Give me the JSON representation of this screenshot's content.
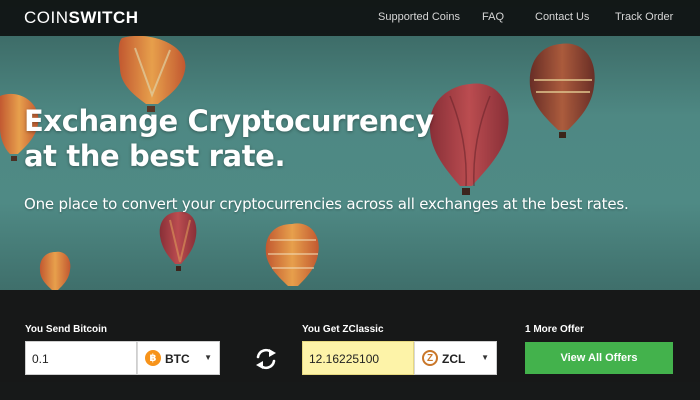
{
  "header": {
    "logo_part1": "COIN",
    "logo_part2": "SWITCH",
    "nav": [
      "Supported Coins",
      "FAQ",
      "Contact Us",
      "Track Order"
    ]
  },
  "hero": {
    "headline_line1": "Exchange Cryptocurrency",
    "headline_line2": "at the best rate.",
    "subheadline": "One place to convert your cryptocurrencies across all exchanges at the best rates."
  },
  "exchange": {
    "send": {
      "label": "You Send Bitcoin",
      "amount": "0.1",
      "coin_code": "BTC",
      "coin_icon": "bitcoin-icon",
      "coin_icon_glyph": "฿",
      "coin_color": "#f7931a"
    },
    "swap_icon": "swap-arrows-icon",
    "get": {
      "label": "You Get ZClassic",
      "amount": "12.16225100",
      "coin_code": "ZCL",
      "coin_icon": "zclassic-icon",
      "coin_icon_glyph": "Z",
      "coin_color": "#c9772a"
    },
    "offers": {
      "label": "1 More Offer",
      "button_label": "View All Offers",
      "button_color": "#43b24c"
    }
  }
}
